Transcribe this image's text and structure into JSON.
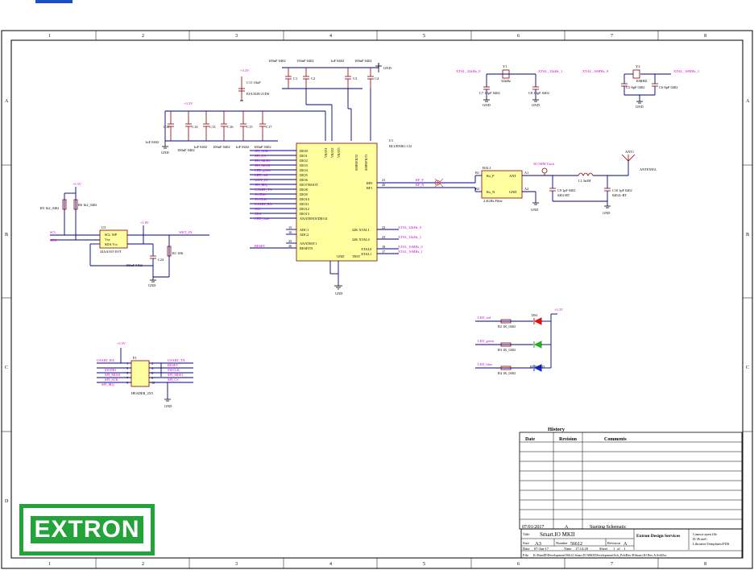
{
  "border": {
    "columns": [
      "1",
      "2",
      "3",
      "4",
      "5",
      "6",
      "7",
      "8"
    ],
    "rows": [
      "A",
      "B",
      "C",
      "D"
    ]
  },
  "nets": {
    "scl": "SCL",
    "sda": "SDA",
    "wkt_in": "WKT_IN",
    "reset": "RESET",
    "xtal_32k_0": "XTAL_32kHz_0",
    "xtal_32k_1": "XTAL_32kHz_1",
    "xtal_16m_0": "XTAL_16MHz_0",
    "xtal_16m_1": "XTAL_16MHz_1",
    "rf_p": "RF_P",
    "rf_n": "RF_N",
    "left_signals": [
      "SPI_SCK",
      "SPI_CS",
      "SPI_MISO",
      "SPI_MOSI",
      "LED_green",
      "LED_red",
      "WKT_IN",
      "SPI_IRQ",
      "USART_TX",
      "SWDIO",
      "SWCLK",
      "USART_RX",
      "SCL",
      "SDA",
      "LED_blue"
    ],
    "led_red": "LED_red",
    "led_green": "LED_green",
    "led_blue": "LED_blue",
    "header_left": [
      "USART_RX",
      "SWDIO",
      "SPI_MOSI",
      "SPI_SCK",
      "SPI_IRQ"
    ],
    "header_right": [
      "USART_TX",
      "RESET",
      "SWCLK",
      "SPI_MISO",
      "SPI_CS"
    ]
  },
  "power": {
    "v33": "+3.3V",
    "v18": "+1.8V",
    "gnd": "GND"
  },
  "components": {
    "u1_ref": "U1",
    "u1_part": "BLUENRG-132",
    "u1_pins_left": [
      "DIO0",
      "DIO1",
      "DIO2",
      "DIO3",
      "DIO4",
      "DIO5",
      "DIO6",
      "DIO7/BOOT",
      "DIO8",
      "DIO9",
      "DIO10",
      "DIO11",
      "DIO12",
      "DIO13",
      "ANATEST0/DIO14"
    ],
    "u1_pins_left2": [
      "ADC1",
      "ADC2",
      "ANATEST1",
      "RESETN"
    ],
    "u1_pins_right": [
      "RF0",
      "RF1",
      "32K XTAL1",
      "32K XTAL0",
      "XTAL0",
      "XTAL1"
    ],
    "u1_pins_top": [
      "VBAT1",
      "VBAT2",
      "VBAT3",
      "SMPSFILT2",
      "SMPSFILT1"
    ],
    "u1_pins_bottom": [
      "TEST",
      "GND"
    ],
    "u1_pin_numbers_right": [
      "21",
      "20",
      "22",
      "23",
      "18",
      "17"
    ],
    "u1_pin_numbers_left2": [
      "15",
      "16",
      "25",
      "26"
    ],
    "u3_ref": "U3",
    "u3_part": "24AA16T-I/OT",
    "u3_pins": [
      "SCL WP",
      "Vss",
      "SDA Vcc"
    ],
    "bal_ref": "BAL1",
    "bal_part": "2.4GHz Filter",
    "bal_pins": [
      "Rx_P",
      "Rx_N",
      "ANT",
      "GND"
    ],
    "bal_pin_nums": [
      "B1",
      "B2",
      "A1",
      "A2"
    ],
    "y1_ref": "Y1",
    "y1_val": "32kHz",
    "y2_ref": "Y2",
    "y2_val": "16MHZ",
    "c7": "C7 15pF 0402",
    "c8": "C8 15pF 0402",
    "c5": "C5 8pF 0402",
    "c6": "C6 8pF 0402",
    "c9": "C9 1pF 0402",
    "c9_part": "0402-RT",
    "c10": "C10 1pF 0402",
    "c10_part": "0402L-RT",
    "c11": "C11 10uF",
    "c11_part": "EIA3528-21DS",
    "cap_top_labels": [
      "100nF 0402",
      "150nF 0402",
      "1uF 0402",
      "100nF 0402"
    ],
    "cap_top_refs": [
      "C1",
      "C2",
      "C3",
      "C4"
    ],
    "cap_bank_refs": [
      "C12",
      "C14",
      "C13",
      "C16",
      "C15",
      "C17"
    ],
    "cap_bank_labels": [
      "1uF 0402",
      "100nF 0402",
      "1uF 0402",
      "100nF 0402",
      "1uF 0402",
      "100nF 0402"
    ],
    "c24": "C24",
    "c24_val": "100nF 0402",
    "r5": "R5 1k2_0402",
    "r6": "R6 1k2_0402",
    "r1": "R1 10K",
    "r2": "R2 1K_0402",
    "r3": "R3 1K_0402",
    "r4": "R4 1K_0402",
    "ds1_ref": "DS1",
    "ds1_part": "RGB LED",
    "l1": "L1 3n3H",
    "ant_ref": "ANT1",
    "ant_name": "ANTENNA",
    "rf_track": "50 OHM Track",
    "p1_ref": "P1",
    "p1_part": "HEADER_2X5",
    "header_left_nums": [
      "1",
      "3",
      "5",
      "7",
      "9"
    ],
    "header_right_nums": [
      "2",
      "4",
      "6",
      "8",
      "10"
    ]
  },
  "history": {
    "title": "History",
    "columns": [
      "Date",
      "Revision",
      "Comments"
    ],
    "rows": [
      {
        "date": "07/01/2017",
        "revision": "A",
        "comments": "Starting Schematic"
      }
    ]
  },
  "title_block": {
    "title_label": "Title",
    "title": "Smart.IO MKII",
    "size_label": "Size",
    "size": "A3",
    "number_label": "Number",
    "number": "56612",
    "revision_label": "Revision",
    "revision": "A",
    "date_label": "Date",
    "date": "07-Jan-17",
    "time_label": "Time",
    "time": "17:14:20",
    "sheet_label": "Sheet",
    "sheet": "1",
    "of_label": "of",
    "sheets": "1",
    "file_label": "File",
    "file": "K:\\RandD\\Development\\56612 Smart.IO MKII\\Development\\Sch_Pcb\\Rev B\\Smart.IO Rev A.SchDoc",
    "company": "Extron Design Services",
    "notes": [
      "Cannot open file",
      "D:\\Protel\\",
      "Libraries\\Templates\\FDS"
    ]
  },
  "logo": {
    "text": "EXTRON",
    "color": "#24a33a"
  }
}
